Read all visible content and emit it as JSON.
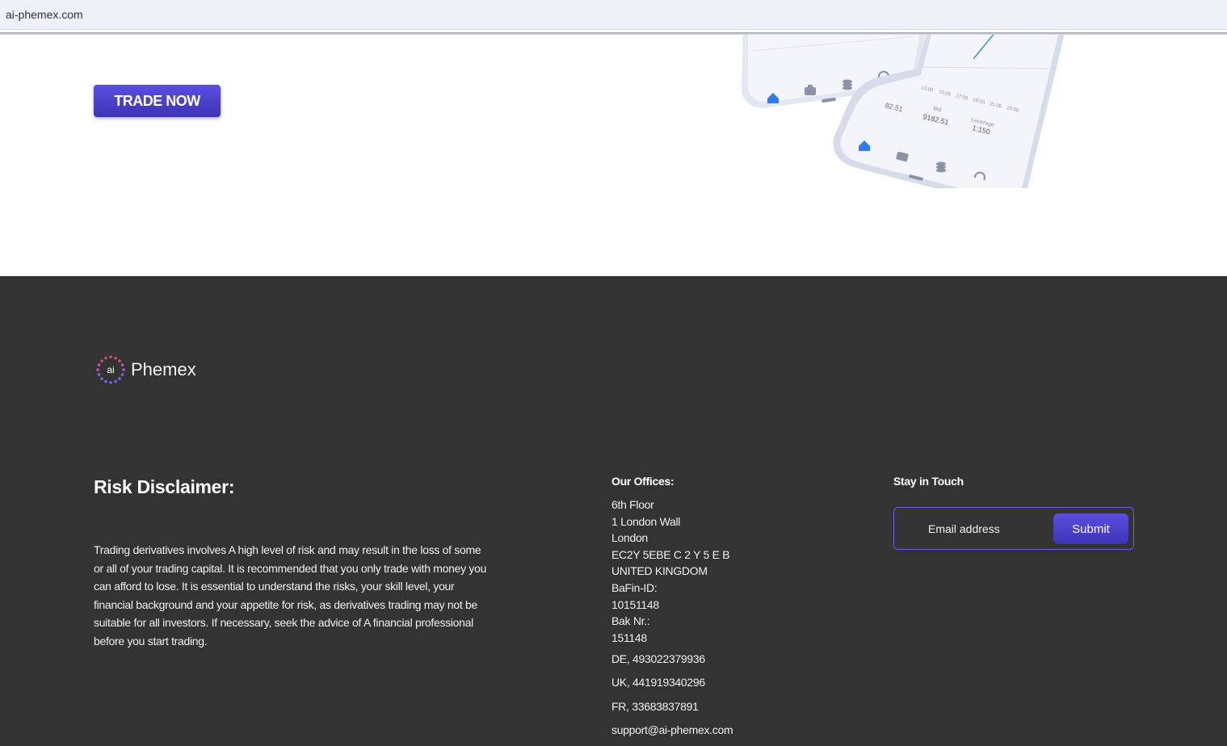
{
  "browser": {
    "url": "ai-phemex.com"
  },
  "hero": {
    "cta_label": "TRADE NOW",
    "phone_readouts": {
      "bid_label": "Bid",
      "bid_value": "9182.51",
      "leverage_label": "Leverage",
      "leverage_value": "1:150",
      "partial_value": "82.51",
      "times": [
        "13:00",
        "15:00",
        "17:00",
        "19:00",
        "21:00",
        "23:00"
      ]
    }
  },
  "footer": {
    "logo": {
      "mark": "ai",
      "name": "Phemex"
    },
    "disclaimer": {
      "title": "Risk Disclaimer:",
      "text": "Trading derivatives involves A high level of risk and may result in the loss of some or all of your trading capital. It is recommended that you only trade with money you can afford to lose. It is essential to understand the risks, your skill level, your financial background and your appetite for risk, as derivatives trading may not be suitable for all investors. If necessary, seek the advice of A financial professional before you start trading."
    },
    "offices": {
      "title": "Our Offices:",
      "lines": [
        "6th Floor",
        "1 London Wall",
        "London",
        "EC2Y 5EBE C 2 Y 5 E B",
        "UNITED KINGDOM",
        "BaFin-ID:",
        "10151148",
        "Bak Nr.:",
        "151148"
      ],
      "phones": [
        "DE, 493022379936",
        "UK, 441919340296",
        "FR, 33683837891"
      ],
      "email": "support@ai-phemex.com"
    },
    "newsletter": {
      "title": "Stay in Touch",
      "email_placeholder": "Email address",
      "submit_label": "Submit"
    }
  },
  "colors": {
    "accent": "#4f44d6",
    "footer_bg": "#333333",
    "icon_blue": "#2d7cf0"
  }
}
